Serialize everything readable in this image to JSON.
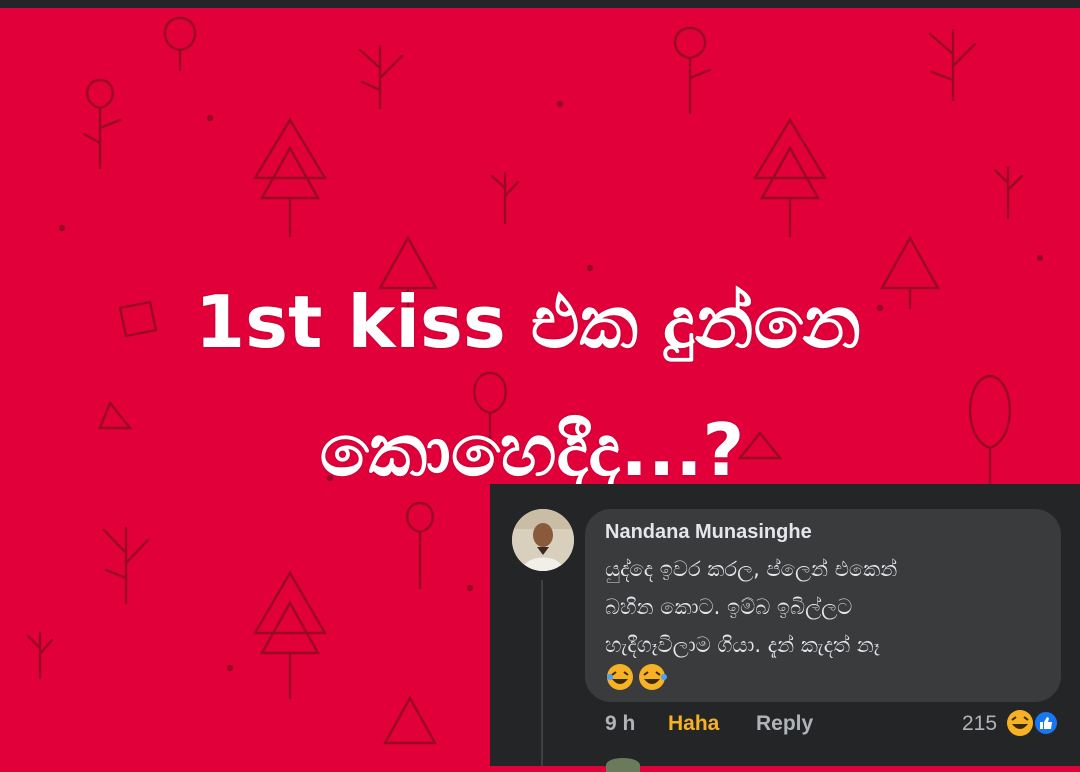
{
  "post": {
    "headline_line1": "1st kiss එක දුන්නෙ",
    "headline_line2": "කොහෙදීද...?",
    "background_color": "#e2003a"
  },
  "comment": {
    "author": "Nandana Munasinghe",
    "text_lines": [
      "යුද්දෙ ඉවර කරල, ප්ලෙන් එකෙන්",
      "බහින කොට. ඉම්බ ඉබිල්ලට",
      "හැදීගෑවිලාම ගියා. දැන් කැදත් නෑ"
    ],
    "emojis": [
      "laughing-emoji",
      "laughing-emoji"
    ],
    "time": "9 h",
    "reaction_label": "Haha",
    "reply_label": "Reply",
    "reaction_count": "215",
    "reaction_icons": [
      "haha-reaction-icon",
      "like-reaction-icon"
    ],
    "colors": {
      "panel": "#242526",
      "bubble": "#3a3b3c",
      "haha": "#f7b125",
      "like": "#1877f2"
    }
  }
}
